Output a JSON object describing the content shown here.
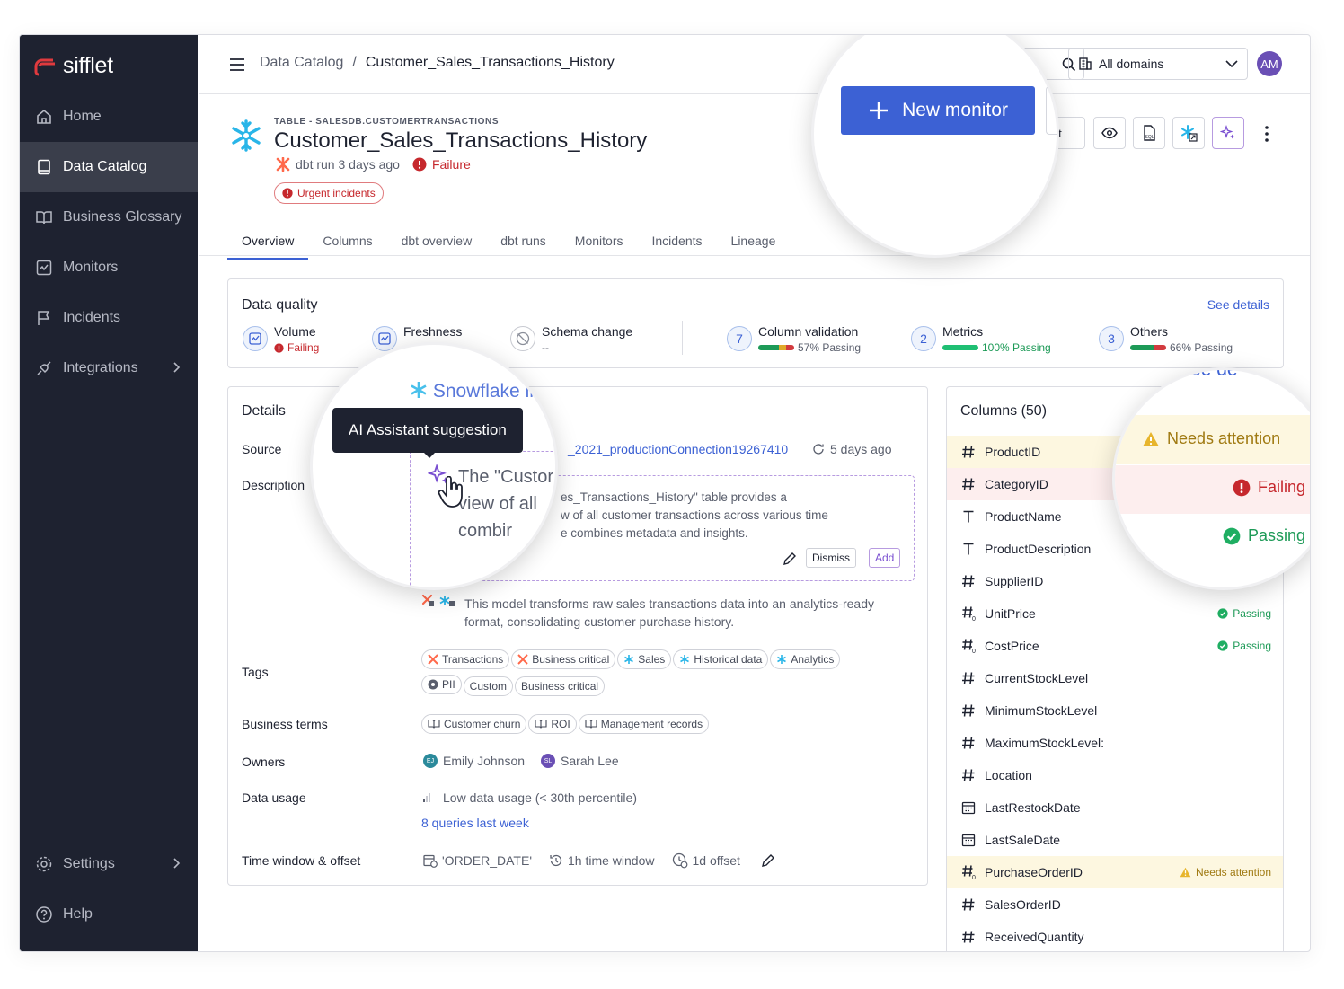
{
  "brand": {
    "name": "sifflet",
    "accent": "#3c61d4",
    "logo_color": "#e03a3e"
  },
  "sidebar": {
    "items": [
      {
        "label": "Home",
        "icon": "home-icon"
      },
      {
        "label": "Data Catalog",
        "icon": "book-icon",
        "active": true
      },
      {
        "label": "Business Glossary",
        "icon": "open-book-icon"
      },
      {
        "label": "Monitors",
        "icon": "monitor-chart-icon"
      },
      {
        "label": "Incidents",
        "icon": "flag-icon"
      },
      {
        "label": "Integrations",
        "icon": "plug-icon"
      }
    ],
    "bottom": [
      {
        "label": "Settings",
        "icon": "gear-icon"
      },
      {
        "label": "Help",
        "icon": "help-icon"
      }
    ]
  },
  "topbar": {
    "breadcrumb_root": "Data Catalog",
    "breadcrumb_sep": "/",
    "breadcrumb_current": "Customer_Sales_Transactions_History",
    "domains_label": "All domains",
    "avatar_initials": "AM"
  },
  "header": {
    "type_label": "TABLE - SALESDB.CUSTOMERTRANSACTIONS",
    "title": "Customer_Sales_Transactions_History",
    "dbt_run": "dbt run 3 days ago",
    "status": "Failure",
    "urgent_badge": "Urgent incidents",
    "new_monitor": "New monitor",
    "edit_partial": "dit"
  },
  "tabs": [
    "Overview",
    "Columns",
    "dbt overview",
    "dbt runs",
    "Monitors",
    "Incidents",
    "Lineage"
  ],
  "data_quality": {
    "title": "Data quality",
    "see_details": "See details",
    "volume": {
      "label": "Volume",
      "status": "Failing"
    },
    "freshness": {
      "label": "Freshness"
    },
    "schema": {
      "label": "Schema change",
      "status": "--"
    },
    "column_validation": {
      "count": "7",
      "label": "Column validation",
      "status": "57% Passing",
      "passing_fraction": 0.57
    },
    "metrics": {
      "count": "2",
      "label": "Metrics",
      "status": "100% Passing",
      "passing_fraction": 1.0
    },
    "others": {
      "count": "3",
      "label": "Others",
      "status": "66% Passing",
      "passing_fraction": 0.66
    }
  },
  "details": {
    "title": "Details",
    "source_label": "Source",
    "source_value": "_2021_productionConnection19267410",
    "source_partial": "Snowflake int",
    "source_updated": "5 days ago",
    "description_label": "Description",
    "ai_suggestion_tooltip": "AI Assistant suggestion",
    "ai_text_left_1": "The \"Custor",
    "ai_text_left_2": "view of all",
    "ai_text_left_3": "combir",
    "ai_text_right_1": "es_Transactions_History\" table provides a",
    "ai_text_right_2": "w of all customer transactions across various time",
    "ai_text_right_3": "e combines metadata and insights.",
    "dismiss": "Dismiss",
    "add": "Add",
    "existing_desc_1": "This model transforms raw sales transactions data into an analytics-ready",
    "existing_desc_2": "format, consolidating customer purchase history.",
    "tags_label": "Tags",
    "tags_row1": [
      "Transactions",
      "Business critical",
      "Sales",
      "Historical data",
      "Analytics"
    ],
    "tags_row2": [
      "PII",
      "Custom",
      "Business critical"
    ],
    "terms_label": "Business terms",
    "terms": [
      "Customer churn",
      "ROI",
      "Management records"
    ],
    "owners_label": "Owners",
    "owners": [
      {
        "initials": "EJ",
        "name": "Emily Johnson"
      },
      {
        "initials": "SL",
        "name": "Sarah Lee"
      }
    ],
    "usage_label": "Data usage",
    "usage_value": "Low data usage (< 30th percentile)",
    "usage_link": "8 queries last week",
    "time_label": "Time window & offset",
    "time_field": "'ORDER_DATE'",
    "time_window": "1h time window",
    "time_offset": "1d offset"
  },
  "columns": {
    "title": "Columns (50)",
    "see_partial": "See de",
    "rows": [
      {
        "name": "ProductID",
        "type": "#",
        "status": ""
      },
      {
        "name": "CategoryID",
        "type": "#",
        "status": ""
      },
      {
        "name": "ProductName",
        "type": "T",
        "status": ""
      },
      {
        "name": "ProductDescription",
        "type": "T",
        "status": ""
      },
      {
        "name": "SupplierID",
        "type": "#",
        "status": ""
      },
      {
        "name": "UnitPrice",
        "type": "#0",
        "status": "Passing"
      },
      {
        "name": "CostPrice",
        "type": "#0",
        "status": "Passing"
      },
      {
        "name": "CurrentStockLevel",
        "type": "#",
        "status": ""
      },
      {
        "name": "MinimumStockLevel",
        "type": "#",
        "status": ""
      },
      {
        "name": "MaximumStockLevel:",
        "type": "#",
        "status": ""
      },
      {
        "name": "Location",
        "type": "#",
        "status": ""
      },
      {
        "name": "LastRestockDate",
        "type": "cal",
        "status": ""
      },
      {
        "name": "LastSaleDate",
        "type": "cal",
        "status": ""
      },
      {
        "name": "PurchaseOrderID",
        "type": "#0",
        "status": "Needs attention"
      },
      {
        "name": "SalesOrderID",
        "type": "#",
        "status": ""
      },
      {
        "name": "ReceivedQuantity",
        "type": "#",
        "status": ""
      }
    ],
    "lens_needs_attention": "Needs attention",
    "lens_failing": "Failing",
    "lens_passing": "Passing"
  }
}
